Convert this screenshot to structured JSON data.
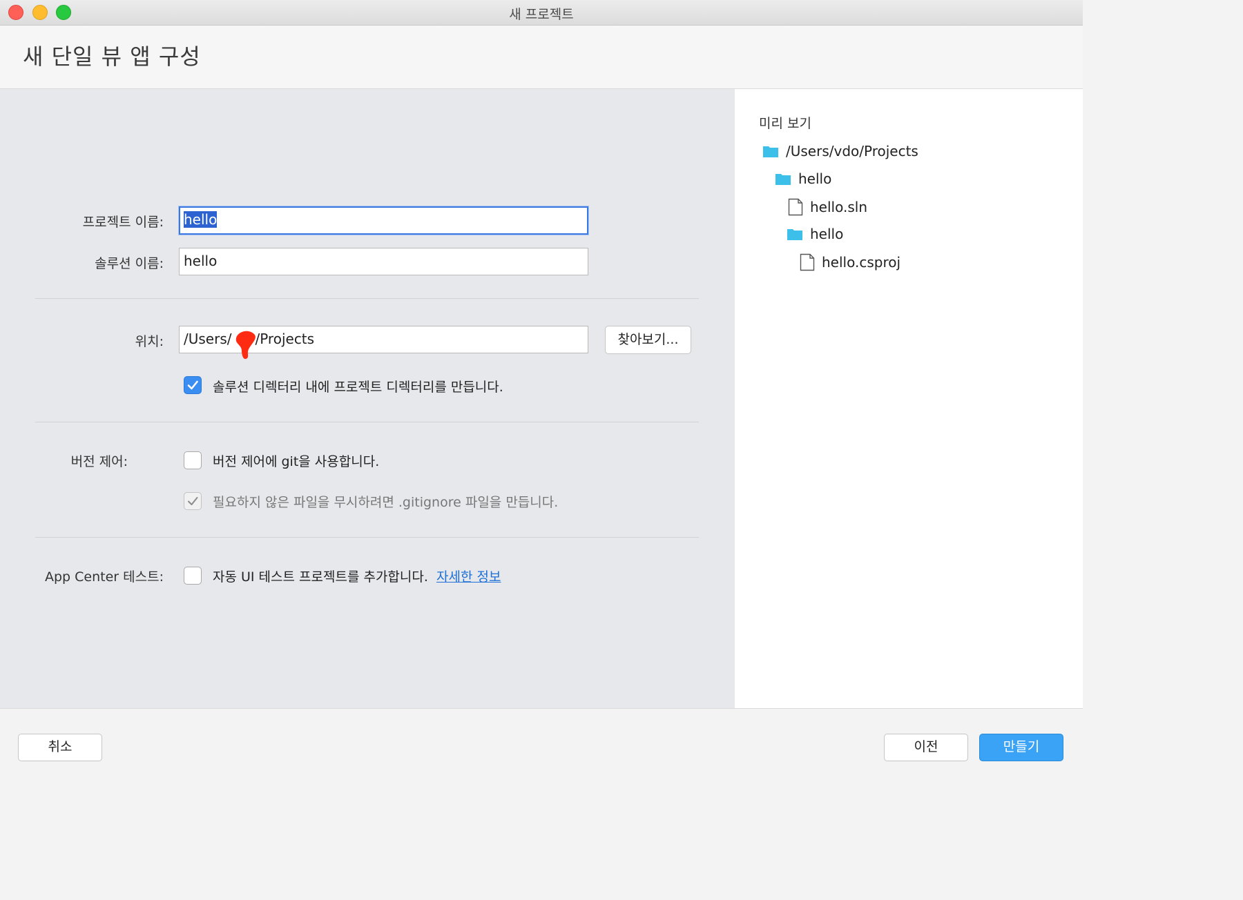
{
  "window": {
    "title": "새 프로젝트"
  },
  "header": {
    "title": "새 단일 뷰 앱 구성"
  },
  "form": {
    "project_name_label": "프로젝트 이름:",
    "project_name_value": "hello",
    "solution_name_label": "솔루션 이름:",
    "solution_name_value": "hello",
    "location_label": "위치:",
    "location_prefix": "/Users/",
    "location_suffix": "/Projects",
    "browse_label": "찾아보기...",
    "create_dir_checkbox": {
      "label": "솔루션 디렉터리 내에 프로젝트 디렉터리를 만듭니다.",
      "checked": true
    },
    "version_control_label": "버전 제어:",
    "use_git_checkbox": {
      "label": "버전 제어에 git을 사용합니다.",
      "checked": false
    },
    "gitignore_checkbox": {
      "label": "필요하지 않은 파일을 무시하려면 .gitignore 파일을 만듭니다.",
      "checked": true,
      "enabled": false
    },
    "app_center_label": "App Center 테스트:",
    "ui_test_checkbox": {
      "label": "자동 UI 테스트 프로젝트를 추가합니다.",
      "checked": false
    },
    "more_info_link": "자세한 정보"
  },
  "preview": {
    "title": "미리 보기",
    "tree": [
      {
        "type": "folder",
        "label": "/Users/vdo/Projects",
        "depth": 0
      },
      {
        "type": "folder",
        "label": "hello",
        "depth": 1
      },
      {
        "type": "file",
        "label": "hello.sln",
        "depth": 2
      },
      {
        "type": "folder",
        "label": "hello",
        "depth": 2
      },
      {
        "type": "file",
        "label": "hello.csproj",
        "depth": 3
      }
    ]
  },
  "footer": {
    "cancel_label": "취소",
    "previous_label": "이전",
    "create_label": "만들기"
  },
  "colors": {
    "accent": "#3aa3f5",
    "folder": "#3cc0ea",
    "link": "#1e6fd6"
  }
}
